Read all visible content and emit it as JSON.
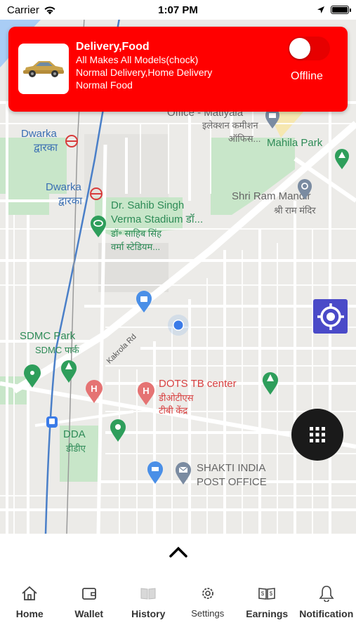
{
  "status_bar": {
    "carrier": "Carrier",
    "time": "1:07 PM",
    "battery_level": 1.0
  },
  "status_card": {
    "title": "Delivery,Food",
    "vehicle": "All Makes All Models(chock)",
    "delivery_types": "Normal Delivery,Home Delivery",
    "food_type": "Normal Food",
    "toggle_state": "off",
    "availability_label": "Offline",
    "accent_color": "#ff0000"
  },
  "map": {
    "labels": {
      "office": "Office - Matiyala",
      "election_office_1": "इलेक्शन कमीशन",
      "election_office_2": "ऑफिस...",
      "dwarka_1": "Dwarka",
      "dwarka_1_hi": "द्वारका",
      "dwarka_2": "Dwarka",
      "dwarka_2_hi": "द्वारका",
      "mahila_park": "Mahila Park",
      "stadium_1": "Dr. Sahib Singh",
      "stadium_2": "Verma Stadium डॉ...",
      "stadium_3": "डॉ॰ साहिब सिंह",
      "stadium_4": "वर्मा स्टेडियम...",
      "ram_mandir": "Shri Ram Mandir",
      "ram_mandir_hi": "श्री राम मंदिर",
      "sdmc_park": "SDMC Park",
      "sdmc_park_hi": "SDMC पार्क",
      "road": "Kakrola Rd",
      "dots": "DOTS TB center",
      "dots_hi_1": "डीओटीएस",
      "dots_hi_2": "टीबी केंद्र",
      "dda": "DDA",
      "dda_hi": "डीडीए",
      "post_1": "SHAKTI INDIA",
      "post_2": "POST OFFICE"
    }
  },
  "icons": {
    "locate": "locate-crosshair-icon",
    "menu": "grid-menu-icon",
    "expand": "chevron-up-icon"
  },
  "tabs": [
    {
      "label": "Home",
      "icon": "home-icon"
    },
    {
      "label": "Wallet",
      "icon": "wallet-icon"
    },
    {
      "label": "History",
      "icon": "book-icon"
    },
    {
      "label": "Settings",
      "icon": "gear-icon"
    },
    {
      "label": "Earnings",
      "icon": "earnings-icon"
    },
    {
      "label": "Notification",
      "icon": "bell-icon"
    }
  ]
}
